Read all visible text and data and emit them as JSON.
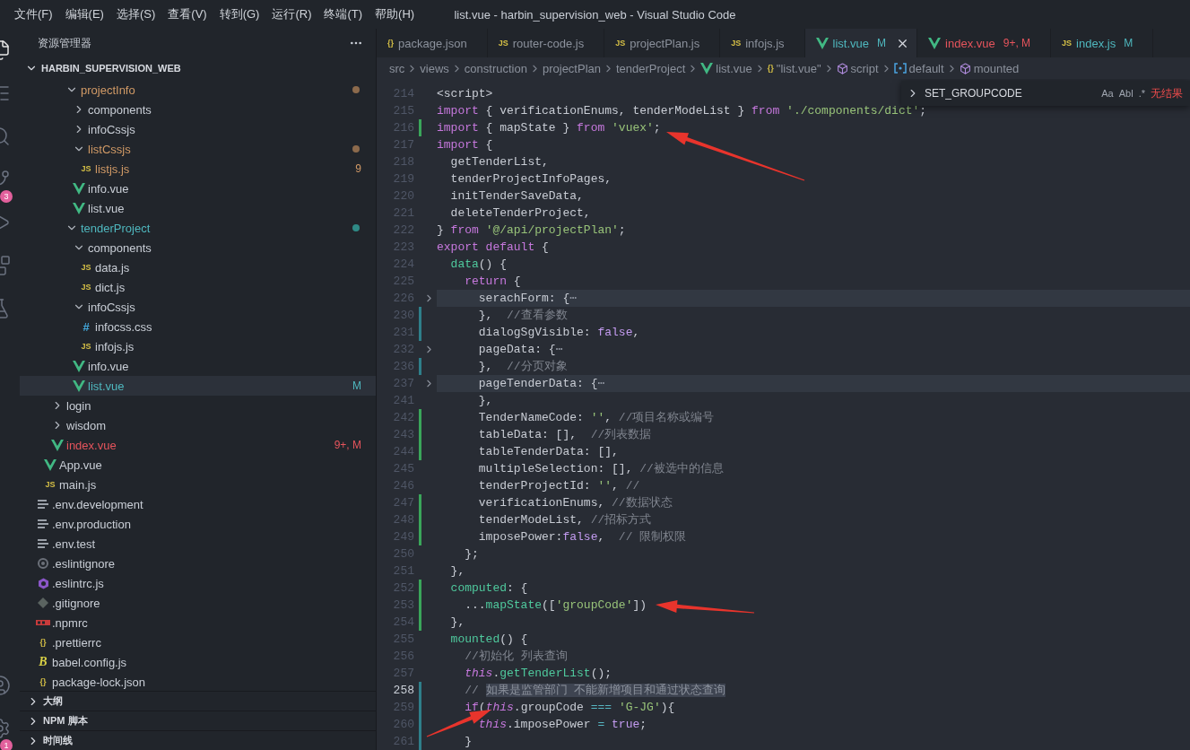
{
  "window": {
    "title": "list.vue - harbin_supervision_web - Visual Studio Code"
  },
  "menu": [
    "文件(F)",
    "编辑(E)",
    "选择(S)",
    "查看(V)",
    "转到(G)",
    "运行(R)",
    "终端(T)",
    "帮助(H)"
  ],
  "activity_bar": {
    "items": [
      {
        "kind": "explorer",
        "selected": true
      },
      {
        "kind": "outline",
        "selected": false
      },
      {
        "kind": "search",
        "selected": false
      },
      {
        "kind": "source-control",
        "selected": false,
        "badge": "3"
      },
      {
        "kind": "run",
        "selected": false
      },
      {
        "kind": "extensions",
        "selected": false
      },
      {
        "kind": "testing",
        "selected": false
      }
    ],
    "bottom": [
      {
        "kind": "account"
      },
      {
        "kind": "settings",
        "badge": "1"
      }
    ]
  },
  "sidebar": {
    "title": "资源管理器",
    "project": "HARBIN_SUPERVISION_WEB",
    "tree": [
      {
        "children": [
          {
            "children": [
              {
                "children": [
                  {
                    "children": [
                      {
                        "label": "projectInfo",
                        "kind": "folder",
                        "expanded": true,
                        "color": "#d19a66",
                        "dot": {
                          "color": "#8c6a4c"
                        },
                        "selected": false,
                        "children": [
                          {
                            "label": "components",
                            "kind": "folder",
                            "expanded": false,
                            "selected": false
                          },
                          {
                            "label": "infoCssjs",
                            "kind": "folder",
                            "expanded": false,
                            "selected": false
                          },
                          {
                            "label": "listCssjs",
                            "kind": "folder",
                            "expanded": true,
                            "color": "#d19a66",
                            "dot": {
                              "color": "#8c6a4c"
                            },
                            "selected": false,
                            "children": [
                              {
                                "label": "listjs.js",
                                "kind": "js",
                                "glyph": "JS",
                                "color": "#d19a66",
                                "badge": "9",
                                "selected": false
                              }
                            ]
                          },
                          {
                            "label": "info.vue",
                            "kind": "vue",
                            "selected": false
                          },
                          {
                            "label": "list.vue",
                            "kind": "vue",
                            "selected": false
                          }
                        ]
                      },
                      {
                        "label": "tenderProject",
                        "kind": "folder",
                        "expanded": true,
                        "color": "#4fb8bf",
                        "dot": {
                          "color": "#2f8a86"
                        },
                        "selected": false,
                        "children": [
                          {
                            "label": "components",
                            "kind": "folder",
                            "expanded": true,
                            "selected": false,
                            "children": [
                              {
                                "label": "data.js",
                                "kind": "js",
                                "glyph": "JS",
                                "selected": false
                              },
                              {
                                "label": "dict.js",
                                "kind": "js",
                                "glyph": "JS",
                                "selected": false
                              }
                            ]
                          },
                          {
                            "label": "infoCssjs",
                            "kind": "folder",
                            "expanded": true,
                            "selected": false,
                            "children": [
                              {
                                "label": "infocss.css",
                                "kind": "css",
                                "glyph": "#",
                                "selected": false
                              },
                              {
                                "label": "infojs.js",
                                "kind": "js",
                                "glyph": "JS",
                                "selected": false
                              }
                            ]
                          },
                          {
                            "label": "info.vue",
                            "kind": "vue",
                            "selected": false
                          },
                          {
                            "label": "list.vue",
                            "kind": "vue",
                            "color": "#4fb8bf",
                            "badge": "M",
                            "selected": true
                          }
                        ]
                      }
                    ]
                  }
                ]
              },
              {
                "label": "login",
                "kind": "folder",
                "expanded": false,
                "selected": false
              },
              {
                "label": "wisdom",
                "kind": "folder",
                "expanded": false,
                "selected": false
              },
              {
                "label": "index.vue",
                "kind": "vue",
                "color": "#e5545c",
                "badge": "9+, M",
                "selected": false
              }
            ]
          },
          {
            "label": "App.vue",
            "kind": "vue",
            "selected": false
          },
          {
            "label": "main.js",
            "kind": "js",
            "glyph": "JS",
            "selected": false
          }
        ]
      },
      {
        "label": ".env.development",
        "kind": "env",
        "selected": false
      },
      {
        "label": ".env.production",
        "kind": "env",
        "selected": false
      },
      {
        "label": ".env.test",
        "kind": "env",
        "selected": false
      },
      {
        "label": ".eslintignore",
        "kind": "ignore",
        "selected": false
      },
      {
        "label": ".eslintrc.js",
        "kind": "eslint",
        "selected": false
      },
      {
        "label": ".gitignore",
        "kind": "git",
        "selected": false
      },
      {
        "label": ".npmrc",
        "kind": "npm",
        "selected": false
      },
      {
        "label": ".prettierrc",
        "kind": "json",
        "glyph": "{}",
        "selected": false
      },
      {
        "label": "babel.config.js",
        "kind": "babel",
        "glyph": "B",
        "selected": false
      },
      {
        "label": "package-lock.json",
        "kind": "json",
        "glyph": "{}",
        "selected": false
      }
    ],
    "panels": [
      {
        "label": "大纲",
        "expanded": false
      },
      {
        "label": "NPM 脚本",
        "expanded": false
      },
      {
        "label": "时间线",
        "expanded": false
      }
    ]
  },
  "tabs": [
    {
      "label": "package.json",
      "kind": "json",
      "glyph": "{}",
      "selected": false
    },
    {
      "label": "router-code.js",
      "kind": "js",
      "glyph": "JS",
      "selected": false
    },
    {
      "label": "projectPlan.js",
      "kind": "js",
      "glyph": "JS",
      "selected": false
    },
    {
      "label": "infojs.js",
      "kind": "js",
      "glyph": "JS",
      "selected": false
    },
    {
      "label": "list.vue",
      "kind": "vue",
      "color": "#4fb8bf",
      "badge": "M",
      "selected": true
    },
    {
      "label": "index.vue",
      "kind": "vue",
      "color": "#e5545c",
      "badge": "9+, M",
      "selected": false
    },
    {
      "label": "index.js",
      "kind": "js",
      "glyph": "JS",
      "color": "#4fb8bf",
      "badge": "M",
      "selected": false
    }
  ],
  "breadcrumbs": [
    {
      "label": "src",
      "kind": "text"
    },
    {
      "label": "views",
      "kind": "text"
    },
    {
      "label": "construction",
      "kind": "text"
    },
    {
      "label": "projectPlan",
      "kind": "text"
    },
    {
      "label": "tenderProject",
      "kind": "text"
    },
    {
      "label": "list.vue",
      "kind": "vue"
    },
    {
      "label": "\"list.vue\"",
      "kind": "braces",
      "glyph": "{}"
    },
    {
      "label": "script",
      "kind": "cube"
    },
    {
      "label": "default",
      "kind": "brackets"
    },
    {
      "label": "mounted",
      "kind": "cube"
    }
  ],
  "find": {
    "value": "SET_GROUPCODE",
    "options": [
      "Aa",
      "Abl",
      ".*"
    ],
    "result": "无结果"
  },
  "code": [
    {
      "number": "214",
      "folded": false,
      "highlighted": false,
      "current": false,
      "tokens": [
        {
          "kind": "tag",
          "text": "<script>"
        }
      ]
    },
    {
      "number": "215",
      "folded": false,
      "highlighted": false,
      "current": false,
      "tokens": [
        {
          "kind": "keyword",
          "text": "import"
        },
        {
          "kind": "plain",
          "text": " { verificationEnums, tenderModeList } "
        },
        {
          "kind": "keyword",
          "text": "from"
        },
        {
          "kind": "string",
          "text": " './components/dict'"
        },
        {
          "kind": "plain",
          "text": ";"
        }
      ]
    },
    {
      "number": "216",
      "change": {
        "color": "#3aa55a"
      },
      "folded": false,
      "highlighted": false,
      "current": false,
      "arrow": {
        "kind": "from-lower-right"
      },
      "tokens": [
        {
          "kind": "keyword",
          "text": "import"
        },
        {
          "kind": "plain",
          "text": " { mapState } "
        },
        {
          "kind": "keyword",
          "text": "from"
        },
        {
          "kind": "string",
          "text": " 'vuex'"
        },
        {
          "kind": "plain",
          "text": ";"
        }
      ]
    },
    {
      "number": "217",
      "folded": false,
      "highlighted": false,
      "current": false,
      "tokens": [
        {
          "kind": "keyword",
          "text": "import"
        },
        {
          "kind": "plain",
          "text": " {"
        }
      ]
    },
    {
      "number": "218",
      "folded": false,
      "highlighted": false,
      "current": false,
      "tokens": [
        {
          "kind": "plain",
          "text": "  getTenderList,"
        }
      ]
    },
    {
      "number": "219",
      "folded": false,
      "highlighted": false,
      "current": false,
      "tokens": [
        {
          "kind": "plain",
          "text": "  tenderProjectInfoPages,"
        }
      ]
    },
    {
      "number": "220",
      "folded": false,
      "highlighted": false,
      "current": false,
      "tokens": [
        {
          "kind": "plain",
          "text": "  initTenderSaveData,"
        }
      ]
    },
    {
      "number": "221",
      "folded": false,
      "highlighted": false,
      "current": false,
      "tokens": [
        {
          "kind": "plain",
          "text": "  deleteTenderProject,"
        }
      ]
    },
    {
      "number": "222",
      "folded": false,
      "highlighted": false,
      "current": false,
      "tokens": [
        {
          "kind": "plain",
          "text": "} "
        },
        {
          "kind": "keyword",
          "text": "from"
        },
        {
          "kind": "string",
          "text": " '@/api/projectPlan'"
        },
        {
          "kind": "plain",
          "text": ";"
        }
      ]
    },
    {
      "number": "223",
      "folded": false,
      "highlighted": false,
      "current": false,
      "tokens": [
        {
          "kind": "keyword",
          "text": "export"
        },
        {
          "kind": "keyword",
          "text": " default"
        },
        {
          "kind": "plain",
          "text": " {"
        }
      ]
    },
    {
      "number": "224",
      "folded": false,
      "highlighted": false,
      "current": false,
      "tokens": [
        {
          "kind": "function",
          "text": "  data"
        },
        {
          "kind": "plain",
          "text": "() {"
        }
      ]
    },
    {
      "number": "225",
      "folded": false,
      "highlighted": false,
      "current": false,
      "tokens": [
        {
          "kind": "keyword",
          "text": "    return"
        },
        {
          "kind": "plain",
          "text": " {"
        }
      ]
    },
    {
      "number": "226",
      "folded": true,
      "highlighted": true,
      "current": false,
      "tokens": [
        {
          "kind": "plain",
          "text": "      serachForm: {"
        },
        {
          "kind": "fold",
          "text": "⋯"
        }
      ]
    },
    {
      "number": "230",
      "change": {
        "color": "#2f7f8a"
      },
      "folded": false,
      "highlighted": false,
      "current": false,
      "tokens": [
        {
          "kind": "plain",
          "text": "      },  "
        },
        {
          "kind": "comment",
          "text": "//查看参数"
        }
      ]
    },
    {
      "number": "231",
      "change": {
        "color": "#2f7f8a"
      },
      "folded": false,
      "highlighted": false,
      "current": false,
      "tokens": [
        {
          "kind": "plain",
          "text": "      dialogSgVisible: "
        },
        {
          "kind": "boolean",
          "text": "false"
        },
        {
          "kind": "plain",
          "text": ","
        }
      ]
    },
    {
      "number": "232",
      "folded": true,
      "highlighted": false,
      "current": false,
      "tokens": [
        {
          "kind": "plain",
          "text": "      pageData: {"
        },
        {
          "kind": "fold",
          "text": "⋯"
        }
      ]
    },
    {
      "number": "236",
      "change": {
        "color": "#2f7f8a"
      },
      "folded": false,
      "highlighted": false,
      "current": false,
      "tokens": [
        {
          "kind": "plain",
          "text": "      },  "
        },
        {
          "kind": "comment",
          "text": "//分页对象"
        }
      ]
    },
    {
      "number": "237",
      "folded": true,
      "highlighted": true,
      "current": false,
      "tokens": [
        {
          "kind": "plain",
          "text": "      pageTenderData: {"
        },
        {
          "kind": "fold",
          "text": "⋯"
        }
      ]
    },
    {
      "number": "241",
      "folded": false,
      "highlighted": false,
      "current": false,
      "tokens": [
        {
          "kind": "plain",
          "text": "      },"
        }
      ]
    },
    {
      "number": "242",
      "change": {
        "color": "#3aa55a"
      },
      "folded": false,
      "highlighted": false,
      "current": false,
      "tokens": [
        {
          "kind": "plain",
          "text": "      TenderNameCode: "
        },
        {
          "kind": "string",
          "text": "''"
        },
        {
          "kind": "plain",
          "text": ", "
        },
        {
          "kind": "comment",
          "text": "//项目名称或编号"
        }
      ]
    },
    {
      "number": "243",
      "change": {
        "color": "#3aa55a"
      },
      "folded": false,
      "highlighted": false,
      "current": false,
      "tokens": [
        {
          "kind": "plain",
          "text": "      tableData: [],  "
        },
        {
          "kind": "comment",
          "text": "//列表数据"
        }
      ]
    },
    {
      "number": "244",
      "change": {
        "color": "#3aa55a"
      },
      "folded": false,
      "highlighted": false,
      "current": false,
      "tokens": [
        {
          "kind": "plain",
          "text": "      tableTenderData: [],"
        }
      ]
    },
    {
      "number": "245",
      "folded": false,
      "highlighted": false,
      "current": false,
      "tokens": [
        {
          "kind": "plain",
          "text": "      multipleSelection: [], "
        },
        {
          "kind": "comment",
          "text": "//被选中的信息"
        }
      ]
    },
    {
      "number": "246",
      "folded": false,
      "highlighted": false,
      "current": false,
      "tokens": [
        {
          "kind": "plain",
          "text": "      tenderProjectId: "
        },
        {
          "kind": "string",
          "text": "''"
        },
        {
          "kind": "plain",
          "text": ", "
        },
        {
          "kind": "comment",
          "text": "//"
        }
      ]
    },
    {
      "number": "247",
      "change": {
        "color": "#3aa55a"
      },
      "folded": false,
      "highlighted": false,
      "current": false,
      "tokens": [
        {
          "kind": "plain",
          "text": "      verificationEnums, "
        },
        {
          "kind": "comment",
          "text": "//数据状态"
        }
      ]
    },
    {
      "number": "248",
      "change": {
        "color": "#3aa55a"
      },
      "folded": false,
      "highlighted": false,
      "current": false,
      "tokens": [
        {
          "kind": "plain",
          "text": "      tenderModeList, "
        },
        {
          "kind": "comment",
          "text": "//招标方式"
        }
      ]
    },
    {
      "number": "249",
      "change": {
        "color": "#3aa55a"
      },
      "folded": false,
      "highlighted": false,
      "current": false,
      "tokens": [
        {
          "kind": "plain",
          "text": "      imposePower:"
        },
        {
          "kind": "boolean",
          "text": "false"
        },
        {
          "kind": "plain",
          "text": ",  "
        },
        {
          "kind": "comment",
          "text": "// 限制权限"
        }
      ]
    },
    {
      "number": "250",
      "folded": false,
      "highlighted": false,
      "current": false,
      "tokens": [
        {
          "kind": "plain",
          "text": "    };"
        }
      ]
    },
    {
      "number": "251",
      "folded": false,
      "highlighted": false,
      "current": false,
      "tokens": [
        {
          "kind": "plain",
          "text": "  },"
        }
      ]
    },
    {
      "number": "252",
      "change": {
        "color": "#3aa55a"
      },
      "folded": false,
      "highlighted": false,
      "current": false,
      "tokens": [
        {
          "kind": "function",
          "text": "  computed"
        },
        {
          "kind": "plain",
          "text": ": {"
        }
      ]
    },
    {
      "number": "253",
      "change": {
        "color": "#3aa55a"
      },
      "folded": false,
      "highlighted": false,
      "current": false,
      "arrow": {
        "kind": "from-right"
      },
      "tokens": [
        {
          "kind": "plain",
          "text": "    ..."
        },
        {
          "kind": "function",
          "text": "mapState"
        },
        {
          "kind": "plain",
          "text": "(["
        },
        {
          "kind": "string",
          "text": "'groupCode'"
        },
        {
          "kind": "plain",
          "text": "])"
        }
      ]
    },
    {
      "number": "254",
      "change": {
        "color": "#3aa55a"
      },
      "folded": false,
      "highlighted": false,
      "current": false,
      "tokens": [
        {
          "kind": "plain",
          "text": "  },"
        }
      ]
    },
    {
      "number": "255",
      "folded": false,
      "highlighted": false,
      "current": false,
      "tokens": [
        {
          "kind": "function",
          "text": "  mounted"
        },
        {
          "kind": "plain",
          "text": "() {"
        }
      ]
    },
    {
      "number": "256",
      "folded": false,
      "highlighted": false,
      "current": false,
      "tokens": [
        {
          "kind": "comment",
          "text": "    //初始化 列表查询"
        }
      ]
    },
    {
      "number": "257",
      "folded": false,
      "highlighted": false,
      "current": false,
      "tokens": [
        {
          "kind": "this",
          "text": "    this"
        },
        {
          "kind": "plain",
          "text": "."
        },
        {
          "kind": "function",
          "text": "getTenderList"
        },
        {
          "kind": "plain",
          "text": "();"
        }
      ]
    },
    {
      "number": "258",
      "change": {
        "color": "#2f7f8a"
      },
      "folded": false,
      "highlighted": false,
      "current": true,
      "tokens": [
        {
          "kind": "comment",
          "text": "    // "
        },
        {
          "kind": "selection",
          "text": "如果是监管部门 不能新增项目和通过状态查询"
        }
      ]
    },
    {
      "number": "259",
      "change": {
        "color": "#2f7f8a"
      },
      "folded": false,
      "highlighted": false,
      "current": false,
      "arrow": {
        "kind": "from-lower-left"
      },
      "tokens": [
        {
          "kind": "keyword",
          "text": "    if"
        },
        {
          "kind": "plain",
          "text": "("
        },
        {
          "kind": "this",
          "text": "this"
        },
        {
          "kind": "plain",
          "text": ".groupCode "
        },
        {
          "kind": "operator",
          "text": "==="
        },
        {
          "kind": "string",
          "text": " 'G-JG'"
        },
        {
          "kind": "plain",
          "text": "){"
        }
      ]
    },
    {
      "number": "260",
      "change": {
        "color": "#2f7f8a"
      },
      "folded": false,
      "highlighted": false,
      "current": false,
      "tokens": [
        {
          "kind": "this",
          "text": "      this"
        },
        {
          "kind": "plain",
          "text": ".imposePower "
        },
        {
          "kind": "operator",
          "text": "="
        },
        {
          "kind": "boolean",
          "text": " true"
        },
        {
          "kind": "plain",
          "text": ";"
        }
      ]
    },
    {
      "number": "261",
      "change": {
        "color": "#2f7f8a"
      },
      "folded": false,
      "highlighted": false,
      "current": false,
      "tokens": [
        {
          "kind": "plain",
          "text": "    }"
        }
      ]
    }
  ]
}
